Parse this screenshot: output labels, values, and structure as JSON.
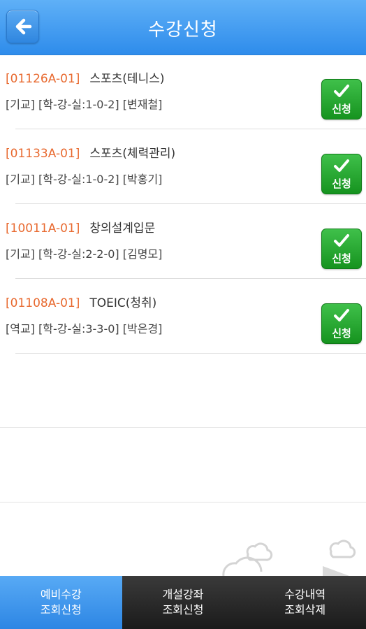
{
  "header": {
    "title": "수강신청",
    "back_icon": "back-arrow-icon"
  },
  "courses": [
    {
      "code": "[01126A-01]",
      "name": "스포츠(테니스)",
      "details": "[기교] [학-강-실:1-0-2] [변재철]",
      "button_label": "신청"
    },
    {
      "code": "[01133A-01]",
      "name": "스포츠(체력관리)",
      "details": "[기교] [학-강-실:1-0-2] [박홍기]",
      "button_label": "신청"
    },
    {
      "code": "[10011A-01]",
      "name": "창의설계입문",
      "details": "[기교] [학-강-실:2-2-0] [김명모]",
      "button_label": "신청"
    },
    {
      "code": "[01108A-01]",
      "name": "TOEIC(청취)",
      "details": "[역교] [학-강-실:3-3-0] [박은경]",
      "button_label": "신청"
    }
  ],
  "tabs": [
    {
      "line1": "예비수강",
      "line2": "조회신청",
      "active": true
    },
    {
      "line1": "개설강좌",
      "line2": "조회신청",
      "active": false
    },
    {
      "line1": "수강내역",
      "line2": "조회삭제",
      "active": false
    }
  ],
  "colors": {
    "header": "#3d98ee",
    "code": "#e8692f",
    "apply": "#22a22c",
    "tab_active": "#3d98ee",
    "tab_inactive": "#262626"
  }
}
